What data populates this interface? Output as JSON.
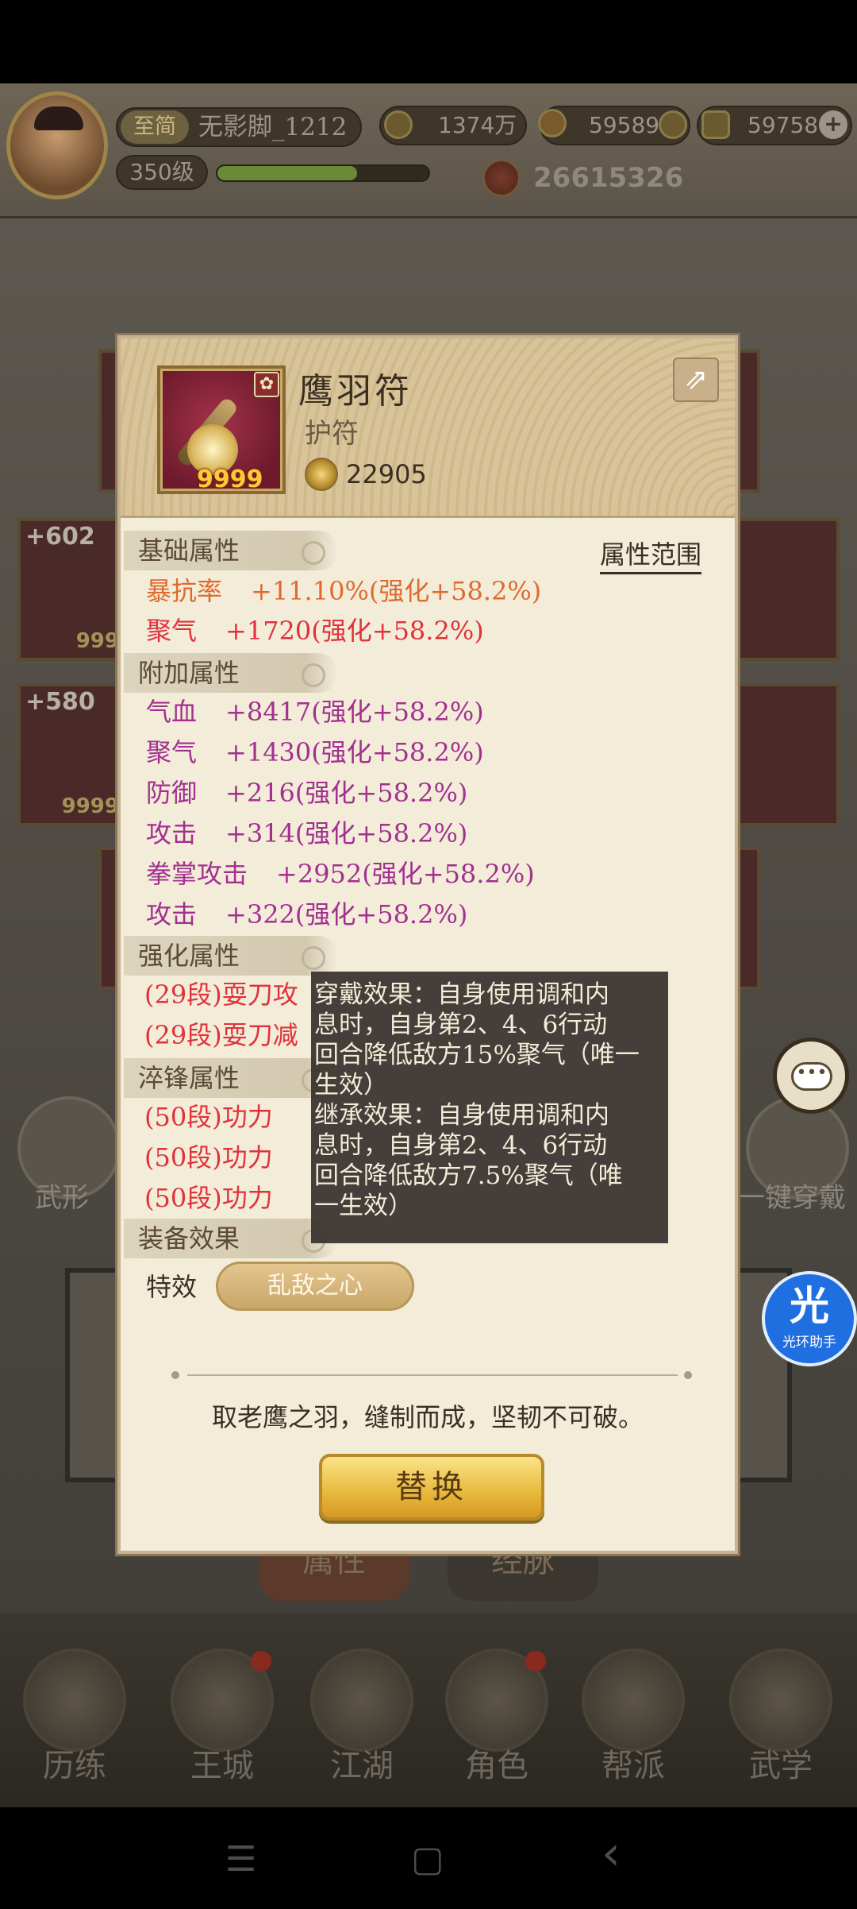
{
  "top_bar": {
    "vip_label": "至简",
    "player_name": "无影脚_1212",
    "level": "350级",
    "exp_fraction": 0.66,
    "copper": "1374万",
    "gold_coin": "59589",
    "ingot": "59758",
    "add_symbol": "+",
    "power": "26615326"
  },
  "background": {
    "items": [
      {
        "num": "+602",
        "count": "999"
      },
      {
        "num": "+580",
        "count": "9999"
      }
    ],
    "left_label": "武形",
    "right_label": "一键穿戴",
    "tabs": [
      "属性",
      "经脉"
    ]
  },
  "popup": {
    "item": {
      "name": "鹰羽符",
      "type": "护符",
      "count": "9999",
      "score": "22905",
      "emblem_icon": "flower-emblem-icon"
    },
    "range_link": "属性范围",
    "sections": {
      "base": "基础属性",
      "extra": "附加属性",
      "enhance": "强化属性",
      "temper": "淬锋属性",
      "effect": "装备效果"
    },
    "base_stats": [
      {
        "name": "暴抗率",
        "value": "+11.10%(强化+58.2%)"
      },
      {
        "name": "聚气",
        "value": "+1720(强化+58.2%)"
      }
    ],
    "extra_stats": [
      {
        "name": "气血",
        "value": "+8417(强化+58.2%)"
      },
      {
        "name": "聚气",
        "value": "+1430(强化+58.2%)"
      },
      {
        "name": "防御",
        "value": "+216(强化+58.2%)"
      },
      {
        "name": "攻击",
        "value": "+314(强化+58.2%)"
      },
      {
        "name": "拳掌攻击",
        "value": "+2952(强化+58.2%)"
      },
      {
        "name": "攻击",
        "value": "+322(强化+58.2%)"
      }
    ],
    "enhance_stats": [
      "(29段)耍刀攻",
      "(29段)耍刀减"
    ],
    "temper_stats": [
      "(50段)功力",
      "(50段)功力",
      "(50段)功力"
    ],
    "special_label": "特效",
    "special_value": "乱敌之心",
    "description": "取老鹰之羽，缝制而成，坚韧不可破。",
    "replace_button": "替换"
  },
  "tooltip": {
    "wear_lines": [
      "穿戴效果：自身使用调和内",
      "息时，自身第2、4、6行动",
      "回合降低敌方15%聚气（唯一",
      "生效）"
    ],
    "inherit_lines": [
      "继承效果：自身使用调和内",
      "息时，自身第2、4、6行动",
      "回合降低敌方7.5%聚气（唯",
      "一生效）"
    ]
  },
  "bottom_nav": [
    "历练",
    "王城",
    "江湖",
    "角色",
    "帮派",
    "武学"
  ],
  "overlay": {
    "assistant_big": "光",
    "assistant_small": "光环助手",
    "chat_icon": "chat-bubble-icon"
  },
  "system_nav": {
    "menu": "☰",
    "home": "▢",
    "back": "‹"
  }
}
